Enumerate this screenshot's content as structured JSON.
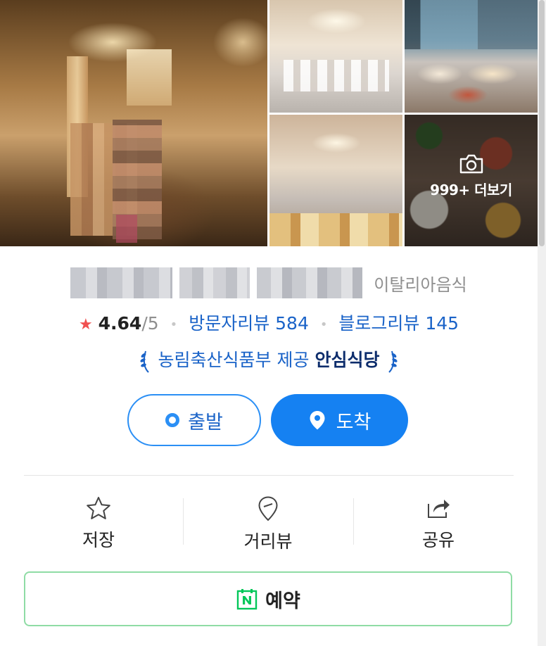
{
  "photos": {
    "more_label": "999+ 더보기"
  },
  "place": {
    "category": "이탈리아음식",
    "rating": "4.64",
    "rating_max": "/5",
    "visitor_reviews": "방문자리뷰 584",
    "blog_reviews": "블로그리뷰 145",
    "badge_prefix": "농림축산식품부 제공",
    "badge_strong": "안심식당"
  },
  "navigation": {
    "depart_label": "출발",
    "arrive_label": "도착"
  },
  "actions": [
    {
      "label": "저장",
      "icon": "star-outline-icon"
    },
    {
      "label": "거리뷰",
      "icon": "map-pin-outline-icon"
    },
    {
      "label": "공유",
      "icon": "share-icon"
    }
  ],
  "reservation": {
    "label": "예약",
    "icon": "naver-booking-icon"
  },
  "colors": {
    "primary": "#1581f2",
    "link": "#1a63c8",
    "star": "#f04f4f",
    "reserve_border": "#8fdca5",
    "naver_green": "#03c75a"
  }
}
